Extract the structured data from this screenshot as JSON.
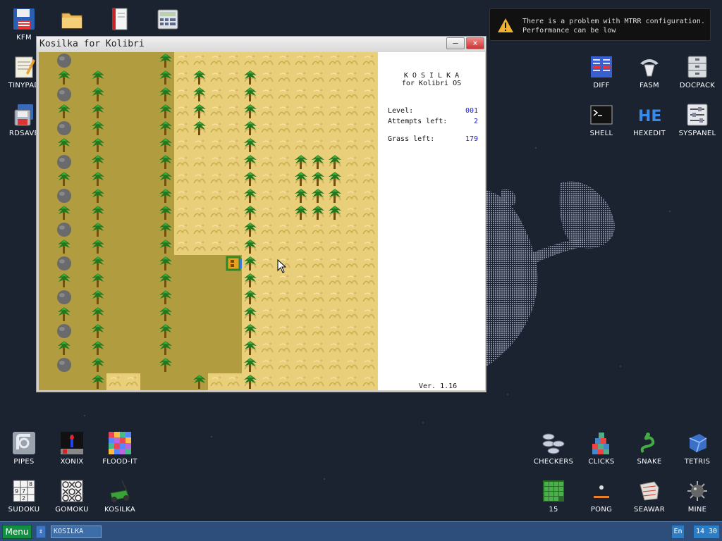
{
  "desktop": {
    "left_icons": [
      {
        "label": "KFM",
        "icon": "floppy-disk-icon"
      },
      {
        "label": "TINYPAD",
        "icon": "notepad-icon"
      },
      {
        "label": "RDSAVE",
        "icon": "floppy-save-icon"
      },
      {
        "label": "PIPES",
        "icon": "pipes-icon"
      },
      {
        "label": "XONIX",
        "icon": "xonix-icon"
      },
      {
        "label": "FLOOD-IT",
        "icon": "flood-it-icon"
      },
      {
        "label": "SUDOKU",
        "icon": "sudoku-icon"
      },
      {
        "label": "GOMOKU",
        "icon": "gomoku-icon"
      },
      {
        "label": "KOSILKA",
        "icon": "lawnmower-icon"
      }
    ],
    "top_icons": [
      {
        "label": "",
        "icon": "folder-icon"
      },
      {
        "label": "",
        "icon": "book-icon"
      },
      {
        "label": "",
        "icon": "calculator-icon"
      }
    ],
    "right_icons": [
      {
        "label": "DIFF",
        "icon": "diff-icon"
      },
      {
        "label": "FASM",
        "icon": "fasm-icon"
      },
      {
        "label": "DOCPACK",
        "icon": "docpack-icon"
      },
      {
        "label": "SHELL",
        "icon": "terminal-icon"
      },
      {
        "label": "HEXEDIT",
        "icon": "hexedit-icon"
      },
      {
        "label": "SYSPANEL",
        "icon": "syspanel-icon"
      },
      {
        "label": "CHECKERS",
        "icon": "checkers-icon"
      },
      {
        "label": "CLICKS",
        "icon": "clicks-icon"
      },
      {
        "label": "SNAKE",
        "icon": "snake-icon"
      },
      {
        "label": "TETRIS",
        "icon": "tetris-icon"
      },
      {
        "label": "15",
        "icon": "fifteen-puzzle-icon"
      },
      {
        "label": "PONG",
        "icon": "pong-icon"
      },
      {
        "label": "SEAWAR",
        "icon": "seawar-icon"
      },
      {
        "label": "MINE",
        "icon": "mine-icon"
      }
    ]
  },
  "notification": {
    "line1": "There is a problem with MTRR configuration.",
    "line2": "Performance can be low",
    "icon": "warning-icon"
  },
  "window": {
    "title": "Kosilka for Kolibri",
    "minimize": "–",
    "close": "×"
  },
  "panel": {
    "heading": "K O S I L K A",
    "subheading": "for Kolibri OS",
    "level_label": "Level:",
    "level_value": "001",
    "attempts_label": "Attempts left:",
    "attempts_value": "2",
    "grass_label": "Grass left:",
    "grass_value": "179",
    "version": "Ver. 1.16"
  },
  "taskbar": {
    "menu_label": "Menu",
    "task_label": "KOSILKA",
    "lang": "En",
    "clock": "14 30"
  },
  "colors": {
    "field_mowed": "#b19c3f",
    "field_grass": "#e9cf7a",
    "panel_value": "#1a1ad0",
    "taskbar": "#2d4d7a",
    "menu_green": "#109040"
  }
}
